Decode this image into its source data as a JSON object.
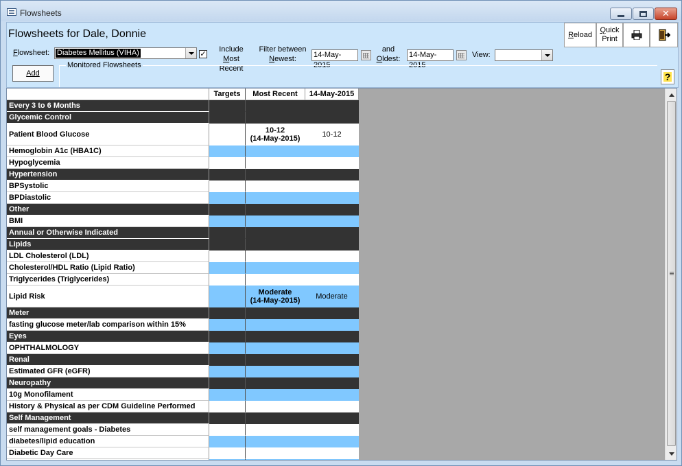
{
  "window": {
    "title": "Flowsheets",
    "icon": "app-window-icon"
  },
  "header": {
    "title": "Flowsheets for Dale, Donnie",
    "flowsheet_label": "Flowsheet:",
    "flowsheet_value": "Diabetes Mellitus (VIHA)",
    "include_most_recent_line1": "Include Most",
    "include_most_recent_line2": "Recent",
    "include_most_recent_checked": true,
    "filter_between_line1": "Filter between",
    "filter_between_line2": "Newest:",
    "newest_date": "14-May-2015",
    "and_line1": "and",
    "and_line2": "Oldest:",
    "oldest_date": "14-May-2015",
    "view_label": "View:",
    "view_value": "",
    "add_label": "Add",
    "monitored_label": "Monitored Flowsheets"
  },
  "toolbar": {
    "reload_label": "Reload",
    "quick_print_line1": "Quick",
    "quick_print_line2": "Print",
    "print_icon": "printer-icon",
    "exit_icon": "exit-door-icon",
    "help_icon": "help-icon"
  },
  "grid": {
    "columns": [
      "",
      "Targets",
      "Most Recent",
      "14-May-2015"
    ],
    "rows": [
      {
        "type": "header",
        "name": "Every 3 to 6 Months"
      },
      {
        "type": "header",
        "name": "Glycemic Control"
      },
      {
        "type": "white",
        "name": "Patient Blood Glucose",
        "recent": "10-12",
        "recent_date": "(14-May-2015)",
        "value": "10-12",
        "tall": true
      },
      {
        "type": "blue",
        "name": "Hemoglobin A1c (HBA1C)"
      },
      {
        "type": "white",
        "name": "Hypoglycemia"
      },
      {
        "type": "header",
        "name": "Hypertension"
      },
      {
        "type": "white",
        "name": "BPSystolic"
      },
      {
        "type": "blue",
        "name": "BPDiastolic"
      },
      {
        "type": "header",
        "name": "Other"
      },
      {
        "type": "blue",
        "name": "BMI"
      },
      {
        "type": "header",
        "name": "Annual or Otherwise Indicated"
      },
      {
        "type": "header",
        "name": "Lipids"
      },
      {
        "type": "white",
        "name": "LDL Cholesterol (LDL)"
      },
      {
        "type": "blue",
        "name": "Cholesterol/HDL Ratio (Lipid Ratio)"
      },
      {
        "type": "white",
        "name": "Triglycerides (Triglycerides)"
      },
      {
        "type": "blue",
        "name": "Lipid Risk",
        "recent": "Moderate",
        "recent_date": "(14-May-2015)",
        "value": "Moderate",
        "tall": true
      },
      {
        "type": "header",
        "name": "Meter"
      },
      {
        "type": "blue",
        "name": "fasting glucose meter/lab comparison within 15%"
      },
      {
        "type": "header",
        "name": "Eyes"
      },
      {
        "type": "blue",
        "name": "OPHTHALMOLOGY"
      },
      {
        "type": "header",
        "name": "Renal"
      },
      {
        "type": "blue",
        "name": "Estimated GFR (eGFR)"
      },
      {
        "type": "header",
        "name": "Neuropathy"
      },
      {
        "type": "blue",
        "name": "10g Monofilament"
      },
      {
        "type": "white",
        "name": "History & Physical as per CDM Guideline Performed"
      },
      {
        "type": "header",
        "name": "Self Management"
      },
      {
        "type": "white",
        "name": "self management goals - Diabetes"
      },
      {
        "type": "blue",
        "name": "diabetes/lipid education"
      },
      {
        "type": "white",
        "name": "Diabetic Day Care"
      },
      {
        "type": "blue",
        "name": ""
      }
    ]
  }
}
